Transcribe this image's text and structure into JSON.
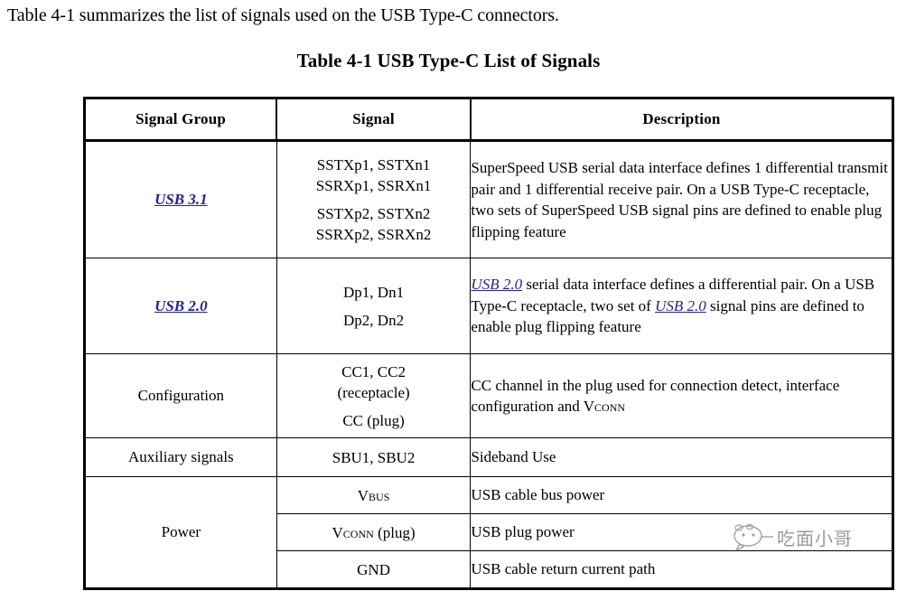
{
  "document": {
    "intro_text": "Table 4-1 summarizes the list of signals used on the USB Type-C connectors.",
    "caption": "Table 4-1  USB Type-C List of Signals",
    "link_color": "#22229c"
  },
  "table": {
    "headers": {
      "group": "Signal Group",
      "signal": "Signal",
      "description": "Description"
    },
    "rows": [
      {
        "group": "USB 3.1",
        "group_is_link": true,
        "signal_lines_a": [
          "SSTXp1, SSTXn1",
          "SSRXp1, SSRXn1"
        ],
        "signal_lines_b": [
          "SSTXp2, SSTXn2",
          "SSRXp2, SSRXn2"
        ],
        "description": "SuperSpeed USB serial data interface defines 1 differential transmit pair and 1 differential receive pair.  On a USB Type-C receptacle, two sets of SuperSpeed USB signal pins are defined to enable plug flipping feature"
      },
      {
        "group": "USB 2.0",
        "group_is_link": true,
        "signal_lines_a": [
          "Dp1, Dn1"
        ],
        "signal_lines_b": [
          "Dp2, Dn2"
        ],
        "desc_link_1": "USB 2.0",
        "desc_part_1": " serial data interface defines a differential pair.  On a USB Type-C receptacle, two set of ",
        "desc_link_2": "USB 2.0",
        "desc_part_2": " signal pins are defined to enable plug flipping feature"
      },
      {
        "group": "Configuration",
        "group_is_link": false,
        "signal_line_1": "CC1, CC2",
        "signal_line_2": "(receptacle)",
        "signal_line_3": "CC",
        "signal_line_3_suffix": " (plug)",
        "desc_part_1": "CC channel in the plug used for connection detect, interface configuration and V",
        "desc_smallcaps": "CONN"
      },
      {
        "group": "Auxiliary signals",
        "group_is_link": false,
        "signal": "SBU1, SBU2",
        "description": "Sideband Use"
      }
    ],
    "power_group": {
      "label": "Power",
      "items": [
        {
          "signal_prefix": "V",
          "signal_smallcaps": "BUS",
          "signal_suffix": "",
          "description": "USB cable bus power"
        },
        {
          "signal_prefix": "V",
          "signal_smallcaps": "CONN",
          "signal_suffix": " (plug)",
          "description": "USB plug power"
        },
        {
          "signal_prefix": "GND",
          "signal_smallcaps": "",
          "signal_suffix": "",
          "description": "USB cable return current path"
        }
      ]
    }
  },
  "watermark": {
    "text": "吃面小哥"
  }
}
